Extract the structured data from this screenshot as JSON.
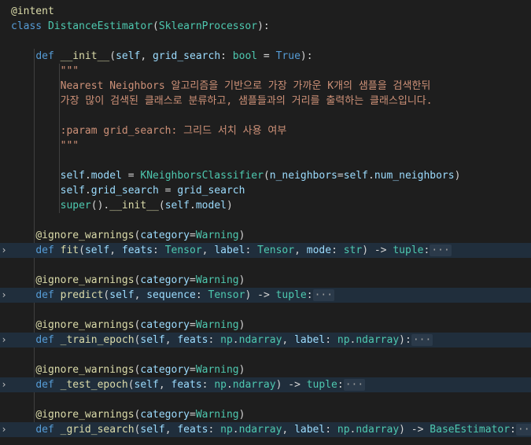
{
  "lines": [
    {
      "folded": false,
      "tokens": [
        {
          "t": "dec",
          "v": "@intent"
        }
      ]
    },
    {
      "folded": false,
      "tokens": [
        {
          "t": "kw",
          "v": "class "
        },
        {
          "t": "cls",
          "v": "DistanceEstimator"
        },
        {
          "t": "plain",
          "v": "("
        },
        {
          "t": "cls",
          "v": "SklearnProcessor"
        },
        {
          "t": "plain",
          "v": "):"
        }
      ]
    },
    {
      "folded": false,
      "tokens": []
    },
    {
      "folded": false,
      "tokens": [
        {
          "t": "plain",
          "v": "    "
        },
        {
          "t": "kw",
          "v": "def "
        },
        {
          "t": "fn",
          "v": "__init__"
        },
        {
          "t": "plain",
          "v": "("
        },
        {
          "t": "param",
          "v": "self"
        },
        {
          "t": "plain",
          "v": ", "
        },
        {
          "t": "param",
          "v": "grid_search"
        },
        {
          "t": "plain",
          "v": ": "
        },
        {
          "t": "cls",
          "v": "bool"
        },
        {
          "t": "plain",
          "v": " = "
        },
        {
          "t": "kw",
          "v": "True"
        },
        {
          "t": "plain",
          "v": "):"
        }
      ]
    },
    {
      "folded": false,
      "tokens": [
        {
          "t": "plain",
          "v": "        "
        },
        {
          "t": "str",
          "v": "\"\"\""
        }
      ]
    },
    {
      "folded": false,
      "tokens": [
        {
          "t": "plain",
          "v": "        "
        },
        {
          "t": "str",
          "v": "Nearest Neighbors 알고리즘을 기반으로 가장 가까운 K개의 샘플을 검색한뒤"
        }
      ]
    },
    {
      "folded": false,
      "tokens": [
        {
          "t": "plain",
          "v": "        "
        },
        {
          "t": "str",
          "v": "가장 많이 검색된 클래스로 분류하고, 샘플들과의 거리를 출력하는 클래스입니다."
        }
      ]
    },
    {
      "folded": false,
      "tokens": []
    },
    {
      "folded": false,
      "tokens": [
        {
          "t": "plain",
          "v": "        "
        },
        {
          "t": "str",
          "v": ":param grid_search: 그리드 서치 사용 여부"
        }
      ]
    },
    {
      "folded": false,
      "tokens": [
        {
          "t": "plain",
          "v": "        "
        },
        {
          "t": "str",
          "v": "\"\"\""
        }
      ]
    },
    {
      "folded": false,
      "tokens": []
    },
    {
      "folded": false,
      "tokens": [
        {
          "t": "plain",
          "v": "        "
        },
        {
          "t": "param",
          "v": "self"
        },
        {
          "t": "plain",
          "v": "."
        },
        {
          "t": "param",
          "v": "model"
        },
        {
          "t": "plain",
          "v": " = "
        },
        {
          "t": "cls",
          "v": "KNeighborsClassifier"
        },
        {
          "t": "plain",
          "v": "("
        },
        {
          "t": "param",
          "v": "n_neighbors"
        },
        {
          "t": "plain",
          "v": "="
        },
        {
          "t": "param",
          "v": "self"
        },
        {
          "t": "plain",
          "v": "."
        },
        {
          "t": "param",
          "v": "num_neighbors"
        },
        {
          "t": "plain",
          "v": ")"
        }
      ]
    },
    {
      "folded": false,
      "tokens": [
        {
          "t": "plain",
          "v": "        "
        },
        {
          "t": "param",
          "v": "self"
        },
        {
          "t": "plain",
          "v": "."
        },
        {
          "t": "param",
          "v": "grid_search"
        },
        {
          "t": "plain",
          "v": " = "
        },
        {
          "t": "param",
          "v": "grid_search"
        }
      ]
    },
    {
      "folded": false,
      "tokens": [
        {
          "t": "plain",
          "v": "        "
        },
        {
          "t": "cls",
          "v": "super"
        },
        {
          "t": "plain",
          "v": "()."
        },
        {
          "t": "fn",
          "v": "__init__"
        },
        {
          "t": "plain",
          "v": "("
        },
        {
          "t": "param",
          "v": "self"
        },
        {
          "t": "plain",
          "v": "."
        },
        {
          "t": "param",
          "v": "model"
        },
        {
          "t": "plain",
          "v": ")"
        }
      ]
    },
    {
      "folded": false,
      "tokens": []
    },
    {
      "folded": false,
      "tokens": [
        {
          "t": "plain",
          "v": "    "
        },
        {
          "t": "dec",
          "v": "@ignore_warnings"
        },
        {
          "t": "plain",
          "v": "("
        },
        {
          "t": "param",
          "v": "category"
        },
        {
          "t": "plain",
          "v": "="
        },
        {
          "t": "cls",
          "v": "Warning"
        },
        {
          "t": "plain",
          "v": ")"
        }
      ]
    },
    {
      "folded": true,
      "tokens": [
        {
          "t": "plain",
          "v": "    "
        },
        {
          "t": "kw",
          "v": "def "
        },
        {
          "t": "fn",
          "v": "fit"
        },
        {
          "t": "plain",
          "v": "("
        },
        {
          "t": "param",
          "v": "self"
        },
        {
          "t": "plain",
          "v": ", "
        },
        {
          "t": "param",
          "v": "feats"
        },
        {
          "t": "plain",
          "v": ": "
        },
        {
          "t": "cls",
          "v": "Tensor"
        },
        {
          "t": "plain",
          "v": ", "
        },
        {
          "t": "param",
          "v": "label"
        },
        {
          "t": "plain",
          "v": ": "
        },
        {
          "t": "cls",
          "v": "Tensor"
        },
        {
          "t": "plain",
          "v": ", "
        },
        {
          "t": "param",
          "v": "mode"
        },
        {
          "t": "plain",
          "v": ": "
        },
        {
          "t": "cls",
          "v": "str"
        },
        {
          "t": "plain",
          "v": ") -> "
        },
        {
          "t": "cls",
          "v": "tuple"
        },
        {
          "t": "plain",
          "v": ":"
        },
        {
          "t": "ell",
          "v": "···"
        }
      ]
    },
    {
      "folded": false,
      "tokens": []
    },
    {
      "folded": false,
      "tokens": [
        {
          "t": "plain",
          "v": "    "
        },
        {
          "t": "dec",
          "v": "@ignore_warnings"
        },
        {
          "t": "plain",
          "v": "("
        },
        {
          "t": "param",
          "v": "category"
        },
        {
          "t": "plain",
          "v": "="
        },
        {
          "t": "cls",
          "v": "Warning"
        },
        {
          "t": "plain",
          "v": ")"
        }
      ]
    },
    {
      "folded": true,
      "tokens": [
        {
          "t": "plain",
          "v": "    "
        },
        {
          "t": "kw",
          "v": "def "
        },
        {
          "t": "fn",
          "v": "predict"
        },
        {
          "t": "plain",
          "v": "("
        },
        {
          "t": "param",
          "v": "self"
        },
        {
          "t": "plain",
          "v": ", "
        },
        {
          "t": "param",
          "v": "sequence"
        },
        {
          "t": "plain",
          "v": ": "
        },
        {
          "t": "cls",
          "v": "Tensor"
        },
        {
          "t": "plain",
          "v": ") -> "
        },
        {
          "t": "cls",
          "v": "tuple"
        },
        {
          "t": "plain",
          "v": ":"
        },
        {
          "t": "ell",
          "v": "···"
        }
      ]
    },
    {
      "folded": false,
      "tokens": []
    },
    {
      "folded": false,
      "tokens": [
        {
          "t": "plain",
          "v": "    "
        },
        {
          "t": "dec",
          "v": "@ignore_warnings"
        },
        {
          "t": "plain",
          "v": "("
        },
        {
          "t": "param",
          "v": "category"
        },
        {
          "t": "plain",
          "v": "="
        },
        {
          "t": "cls",
          "v": "Warning"
        },
        {
          "t": "plain",
          "v": ")"
        }
      ]
    },
    {
      "folded": true,
      "tokens": [
        {
          "t": "plain",
          "v": "    "
        },
        {
          "t": "kw",
          "v": "def "
        },
        {
          "t": "fn",
          "v": "_train_epoch"
        },
        {
          "t": "plain",
          "v": "("
        },
        {
          "t": "param",
          "v": "self"
        },
        {
          "t": "plain",
          "v": ", "
        },
        {
          "t": "param",
          "v": "feats"
        },
        {
          "t": "plain",
          "v": ": "
        },
        {
          "t": "cls",
          "v": "np"
        },
        {
          "t": "plain",
          "v": "."
        },
        {
          "t": "cls",
          "v": "ndarray"
        },
        {
          "t": "plain",
          "v": ", "
        },
        {
          "t": "param",
          "v": "label"
        },
        {
          "t": "plain",
          "v": ": "
        },
        {
          "t": "cls",
          "v": "np"
        },
        {
          "t": "plain",
          "v": "."
        },
        {
          "t": "cls",
          "v": "ndarray"
        },
        {
          "t": "plain",
          "v": "):"
        },
        {
          "t": "ell",
          "v": "···"
        }
      ]
    },
    {
      "folded": false,
      "tokens": []
    },
    {
      "folded": false,
      "tokens": [
        {
          "t": "plain",
          "v": "    "
        },
        {
          "t": "dec",
          "v": "@ignore_warnings"
        },
        {
          "t": "plain",
          "v": "("
        },
        {
          "t": "param",
          "v": "category"
        },
        {
          "t": "plain",
          "v": "="
        },
        {
          "t": "cls",
          "v": "Warning"
        },
        {
          "t": "plain",
          "v": ")"
        }
      ]
    },
    {
      "folded": true,
      "tokens": [
        {
          "t": "plain",
          "v": "    "
        },
        {
          "t": "kw",
          "v": "def "
        },
        {
          "t": "fn",
          "v": "_test_epoch"
        },
        {
          "t": "plain",
          "v": "("
        },
        {
          "t": "param",
          "v": "self"
        },
        {
          "t": "plain",
          "v": ", "
        },
        {
          "t": "param",
          "v": "feats"
        },
        {
          "t": "plain",
          "v": ": "
        },
        {
          "t": "cls",
          "v": "np"
        },
        {
          "t": "plain",
          "v": "."
        },
        {
          "t": "cls",
          "v": "ndarray"
        },
        {
          "t": "plain",
          "v": ") -> "
        },
        {
          "t": "cls",
          "v": "tuple"
        },
        {
          "t": "plain",
          "v": ":"
        },
        {
          "t": "ell",
          "v": "···"
        }
      ]
    },
    {
      "folded": false,
      "tokens": []
    },
    {
      "folded": false,
      "tokens": [
        {
          "t": "plain",
          "v": "    "
        },
        {
          "t": "dec",
          "v": "@ignore_warnings"
        },
        {
          "t": "plain",
          "v": "("
        },
        {
          "t": "param",
          "v": "category"
        },
        {
          "t": "plain",
          "v": "="
        },
        {
          "t": "cls",
          "v": "Warning"
        },
        {
          "t": "plain",
          "v": ")"
        }
      ]
    },
    {
      "folded": true,
      "tokens": [
        {
          "t": "plain",
          "v": "    "
        },
        {
          "t": "kw",
          "v": "def "
        },
        {
          "t": "fn",
          "v": "_grid_search"
        },
        {
          "t": "plain",
          "v": "("
        },
        {
          "t": "param",
          "v": "self"
        },
        {
          "t": "plain",
          "v": ", "
        },
        {
          "t": "param",
          "v": "feats"
        },
        {
          "t": "plain",
          "v": ": "
        },
        {
          "t": "cls",
          "v": "np"
        },
        {
          "t": "plain",
          "v": "."
        },
        {
          "t": "cls",
          "v": "ndarray"
        },
        {
          "t": "plain",
          "v": ", "
        },
        {
          "t": "param",
          "v": "label"
        },
        {
          "t": "plain",
          "v": ": "
        },
        {
          "t": "cls",
          "v": "np"
        },
        {
          "t": "plain",
          "v": "."
        },
        {
          "t": "cls",
          "v": "ndarray"
        },
        {
          "t": "plain",
          "v": ") -> "
        },
        {
          "t": "cls",
          "v": "BaseEstimator"
        },
        {
          "t": "plain",
          "v": ":"
        },
        {
          "t": "ell",
          "v": "···"
        }
      ]
    }
  ],
  "fold_icon": "chevron-right-icon",
  "colors": {
    "background": "#1e1e1e",
    "folded_line": "#202e3c",
    "keyword": "#569cd6",
    "function": "#dcdcaa",
    "class": "#4ec9b0",
    "parameter": "#9cdcfe",
    "string": "#ce9178",
    "text": "#d4d4d4"
  }
}
